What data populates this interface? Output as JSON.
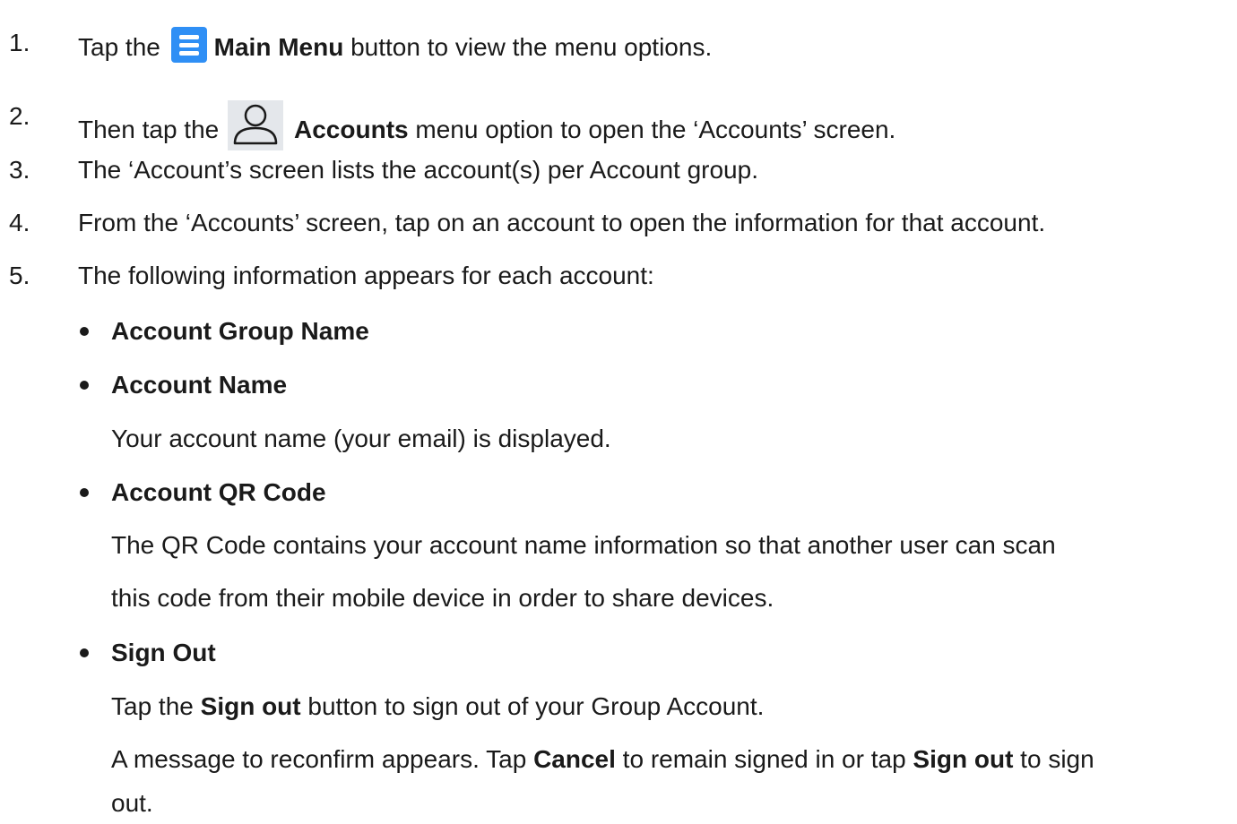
{
  "steps": [
    {
      "num": "1.",
      "before": "Tap the",
      "icon": "main-menu-icon",
      "bold": "Main Menu",
      "after": " button to view the menu options."
    },
    {
      "num": "2.",
      "before": "Then tap the",
      "icon": "account-icon",
      "bold": "Accounts",
      "after": " menu option to open the ‘Accounts’ screen."
    },
    {
      "num": "3.",
      "text": "The ‘Account’s screen lists the account(s) per Account group."
    },
    {
      "num": "4.",
      "text": "From the ‘Accounts’ screen, tap on an account to open the information for that account."
    },
    {
      "num": "5.",
      "text": "The following information appears for each account:"
    }
  ],
  "items": [
    {
      "title": "Account Group Name"
    },
    {
      "title": "Account Name",
      "desc": "Your account name (your email) is displayed."
    },
    {
      "title": "Account QR Code",
      "desc_line1": "The QR Code contains your account name information so that another user can scan",
      "desc_line2": "this code from their mobile device in order to share devices."
    },
    {
      "title": "Sign Out",
      "desc_a_pre": "Tap the ",
      "desc_a_bold": "Sign out",
      "desc_a_post": " button to sign out of your Group Account.",
      "desc_b_pre": "A message to reconfirm appears. Tap ",
      "desc_b_bold1": "Cancel",
      "desc_b_mid": " to remain signed in or tap ",
      "desc_b_bold2": "Sign out",
      "desc_b_post": " to sign",
      "desc_c": "out."
    }
  ],
  "colors": {
    "menu_icon": "#2f8ff5",
    "account_icon_bg": "#e4e7eb",
    "text": "#1a1a1a"
  }
}
